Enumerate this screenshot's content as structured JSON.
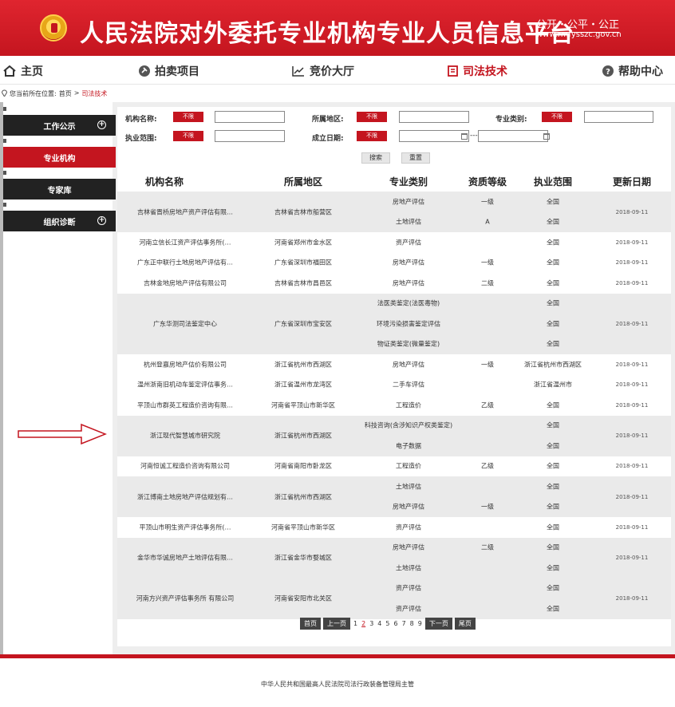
{
  "header": {
    "title": "人民法院对外委托专业机构专业人员信息平台",
    "slogan": "公开・公平・公正",
    "url": "www.rmfysszc.gov.cn"
  },
  "nav": [
    {
      "label": "主页",
      "icon": "home-icon"
    },
    {
      "label": "拍卖项目",
      "icon": "auction-icon"
    },
    {
      "label": "竞价大厅",
      "icon": "chart-icon"
    },
    {
      "label": "司法技术",
      "icon": "document-icon",
      "active": true
    },
    {
      "label": "帮助中心",
      "icon": "help-icon"
    }
  ],
  "breadcrumb": {
    "prefix": "您当前所在位置:",
    "home": "首页",
    "sep": ">",
    "current": "司法技术"
  },
  "sidebar": [
    {
      "label": "工作公示",
      "expand": true
    },
    {
      "label": "专业机构",
      "active": true
    },
    {
      "label": "专家库"
    },
    {
      "label": "组织诊断",
      "expand": true
    }
  ],
  "filters": {
    "name_label": "机构名称:",
    "region_label": "所属地区:",
    "type_label": "专业类别:",
    "scope_label": "执业范围:",
    "date_label": "成立日期:",
    "unlimited": "不限",
    "date_sep": "---",
    "search_btn": "搜索",
    "reset_btn": "重置"
  },
  "table": {
    "headers": [
      "机构名称",
      "所属地区",
      "专业类别",
      "资质等级",
      "执业范围",
      "更新日期"
    ],
    "rows": [
      {
        "name": "吉林省晋桥房地产资产评估有限…",
        "region": "吉林省吉林市船营区",
        "date": "2018-09-11",
        "items": [
          {
            "type": "房地产评估",
            "level": "一级",
            "scope": "全国"
          },
          {
            "type": "土地评估",
            "level": "A",
            "scope": "全国"
          }
        ]
      },
      {
        "name": "河南立信长江资产评估事务所(…",
        "region": "河南省郑州市金水区",
        "date": "2018-09-11",
        "items": [
          {
            "type": "资产评估",
            "level": "",
            "scope": "全国"
          }
        ]
      },
      {
        "name": "广东正中联行土地房地产评估有…",
        "region": "广东省深圳市福田区",
        "date": "2018-09-11",
        "items": [
          {
            "type": "房地产评估",
            "level": "一级",
            "scope": "全国"
          }
        ]
      },
      {
        "name": "吉林金地房地产评估有限公司",
        "region": "吉林省吉林市昌邑区",
        "date": "2018-09-11",
        "items": [
          {
            "type": "房地产评估",
            "level": "二级",
            "scope": "全国"
          }
        ]
      },
      {
        "name": "广东华测司法鉴定中心",
        "region": "广东省深圳市宝安区",
        "date": "2018-09-11",
        "items": [
          {
            "type": "法医类鉴定(法医毒物)",
            "level": "",
            "scope": "全国"
          },
          {
            "type": "环境污染损害鉴定评估",
            "level": "",
            "scope": "全国"
          },
          {
            "type": "物证类鉴定(微量鉴定)",
            "level": "",
            "scope": "全国"
          }
        ]
      },
      {
        "name": "杭州登嘉房地产估价有限公司",
        "region": "浙江省杭州市西湖区",
        "date": "2018-09-11",
        "items": [
          {
            "type": "房地产评估",
            "level": "一级",
            "scope": "浙江省杭州市西湖区"
          }
        ]
      },
      {
        "name": "温州浙南旧机动车鉴定评估事务…",
        "region": "浙江省温州市龙湾区",
        "date": "2018-09-11",
        "items": [
          {
            "type": "二手车评估",
            "level": "",
            "scope": "浙江省温州市"
          }
        ]
      },
      {
        "name": "平顶山市群英工程造价咨询有限…",
        "region": "河南省平顶山市新华区",
        "date": "2018-09-11",
        "items": [
          {
            "type": "工程造价",
            "level": "乙级",
            "scope": "全国"
          }
        ]
      },
      {
        "name": "浙江现代智慧城市研究院",
        "region": "浙江省杭州市西湖区",
        "date": "2018-09-11",
        "items": [
          {
            "type": "科技咨询(含涉知识产权类鉴定)",
            "level": "",
            "scope": "全国"
          },
          {
            "type": "电子数据",
            "level": "",
            "scope": "全国"
          }
        ]
      },
      {
        "name": "河南恒诚工程造价咨询有限公司",
        "region": "河南省南阳市卧龙区",
        "date": "2018-09-11",
        "items": [
          {
            "type": "工程造价",
            "level": "乙级",
            "scope": "全国"
          }
        ]
      },
      {
        "name": "浙江博南土地房地产评估规划有…",
        "region": "浙江省杭州市西湖区",
        "date": "2018-09-11",
        "items": [
          {
            "type": "土地评估",
            "level": "",
            "scope": "全国"
          },
          {
            "type": "房地产评估",
            "level": "一级",
            "scope": "全国"
          }
        ]
      },
      {
        "name": "平顶山市明生资产评估事务所(…",
        "region": "河南省平顶山市新华区",
        "date": "2018-09-11",
        "items": [
          {
            "type": "资产评估",
            "level": "",
            "scope": "全国"
          }
        ]
      },
      {
        "name": "金华市华诚房地产土地评估有限…",
        "region": "浙江省金华市婺城区",
        "date": "2018-09-11",
        "items": [
          {
            "type": "房地产评估",
            "level": "二级",
            "scope": "全国"
          },
          {
            "type": "土地评估",
            "level": "",
            "scope": "全国"
          }
        ]
      },
      {
        "name": "河南方兴资产评估事务所 有限公司",
        "region": "河南省安阳市北关区",
        "date": "2018-09-11",
        "items": [
          {
            "type": "资产评估",
            "level": "",
            "scope": "全国"
          },
          {
            "type": "资产评估",
            "level": "",
            "scope": "全国"
          }
        ]
      }
    ]
  },
  "pager": {
    "first": "首页",
    "prev": "上一页",
    "pages": [
      "1",
      "2",
      "3",
      "4",
      "5",
      "6",
      "7",
      "8",
      "9"
    ],
    "current": "2",
    "next": "下一页",
    "last": "尾页"
  },
  "footer": "中华人民共和国最高人民法院司法行政装备管理局主管",
  "colors": {
    "brand": "#c4151f",
    "dark": "#222222",
    "band": "#eeeeee"
  }
}
